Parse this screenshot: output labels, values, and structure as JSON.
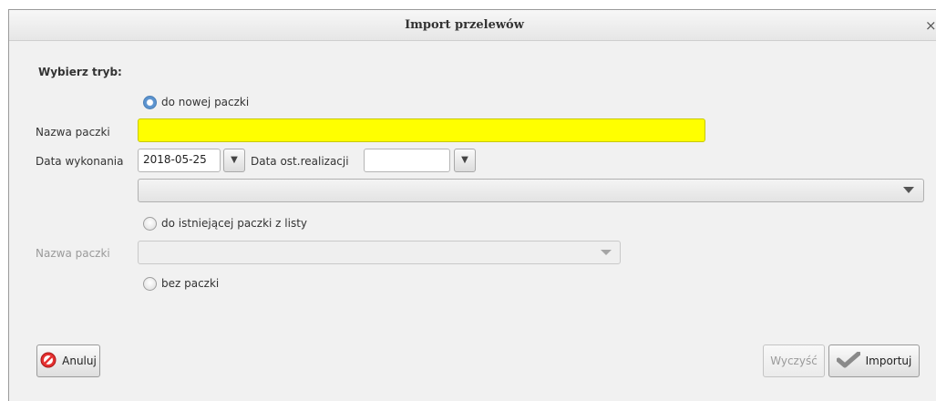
{
  "dialog": {
    "title": "Import przelewów",
    "close_glyph": "×"
  },
  "mode_label": "Wybierz tryb:",
  "options": {
    "new_package": "do nowej paczki",
    "existing_package": "do istniejącej paczki z listy",
    "no_package": "bez paczki",
    "selected": "new_package"
  },
  "new_package_form": {
    "name_label": "Nazwa paczki",
    "name_value": "",
    "execution_date_label": "Data wykonania",
    "execution_date_value": "2018-05-25",
    "last_realization_label": "Data ost.realizacji",
    "last_realization_value": "",
    "account_combo_value": ""
  },
  "existing_package_form": {
    "name_label": "Nazwa paczki",
    "combo_value": ""
  },
  "buttons": {
    "cancel": "Anuluj",
    "clear": "Wyczyść",
    "import": "Importuj"
  },
  "icons": {
    "cancel": "cancel-icon",
    "import": "checkmark-icon",
    "dropdown": "triangle-down-icon"
  },
  "colors": {
    "required_field": "#ffff00",
    "radio_selected": "#5b93cf"
  }
}
